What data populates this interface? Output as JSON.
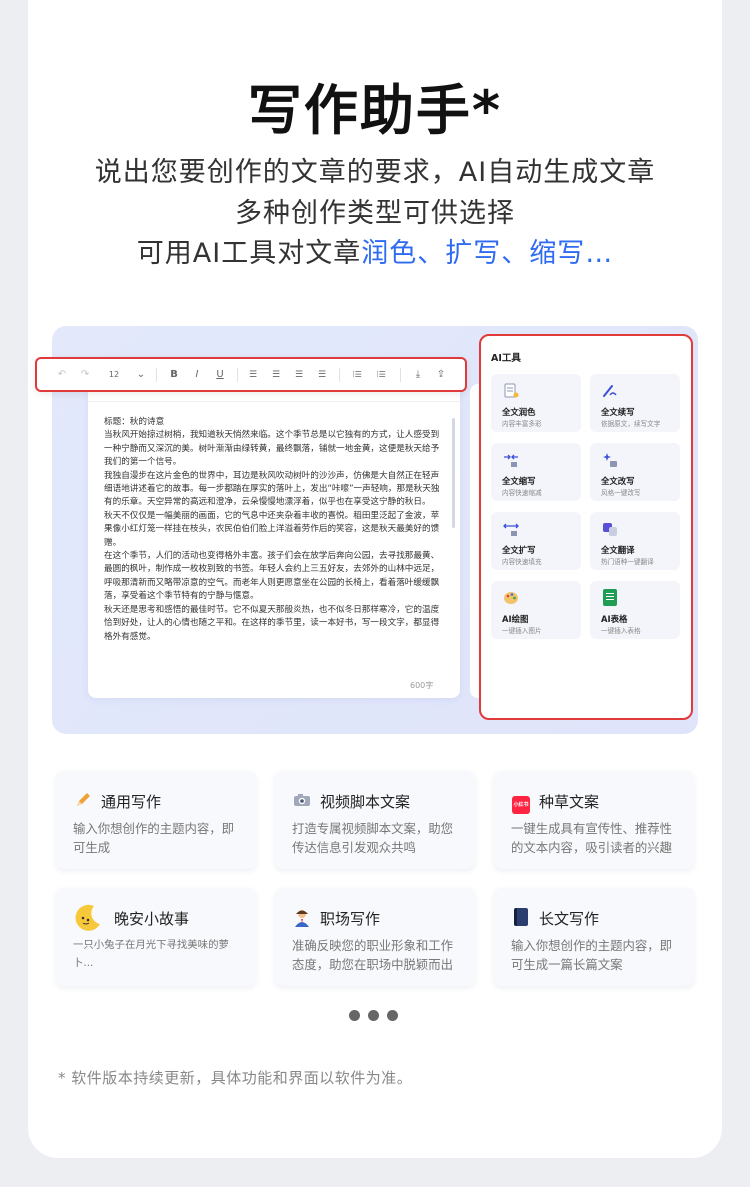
{
  "header": {
    "title": "写作助手*",
    "line1": "说出您要创作的文章的要求，AI自动生成文章",
    "line2": "多种创作类型可供选择",
    "line3_prefix": "可用AI工具对文章",
    "line3_highlight": "润色、扩写、缩写…"
  },
  "toolbar": {
    "undo_icon": "↶",
    "redo_icon": "↷",
    "font_size": "12",
    "dropdown_icon": "⌄",
    "bold": "B",
    "italic": "I",
    "underline": "U",
    "align_left_icon": "☰",
    "align_center_icon": "☰",
    "align_justify_icon": "☰",
    "align_right_icon": "☰",
    "ordered_list_icon": "⁝☰",
    "bullet_list_icon": "⁝☰",
    "download_icon": "⤓",
    "share_icon": "⇪"
  },
  "editor": {
    "text": "标题：秋的诗意\n当秋风开始掠过树梢，我知道秋天悄然来临。这个季节总是以它独有的方式，让人感受到一种宁静而又深沉的美。树叶渐渐由绿转黄，最终飘落，铺就一地金黄，这便是秋天给予我们的第一个信号。\n我独自漫步在这片金色的世界中，耳边是秋风吹动树叶的沙沙声，仿佛是大自然正在轻声细语地讲述着它的故事。每一步都踏在厚实的落叶上，发出“咔嚓”一声轻响，那是秋天独有的乐章。天空异常的高远和澄净，云朵慢慢地漂浮着，似乎也在享受这宁静的秋日。\n秋天不仅仅是一幅美丽的画面，它的气息中还夹杂着丰收的喜悦。稻田里泛起了金波，苹果像小红灯笼一样挂在枝头，农民伯伯们脸上洋溢着劳作后的笑容，这是秋天最美好的馈赠。\n在这个季节，人们的活动也变得格外丰富。孩子们会在放学后奔向公园，去寻找那最黄、最圆的枫叶，制作成一枚枚别致的书签。年轻人会约上三五好友，去郊外的山林中远足，呼吸那清新而又略带凉意的空气。而老年人则更愿意坐在公园的长椅上，看着落叶缓缓飘落，享受着这个季节特有的宁静与惬意。\n秋天还是思考和感悟的最佳时节。它不似夏天那般炎热，也不似冬日那样寒冷，它的温度恰到好处，让人的心情也随之平和。在这样的季节里，读一本好书，写一段文字，都显得格外有感觉。",
    "word_count": "600字"
  },
  "ai_tools": {
    "title": "AI工具",
    "items": [
      {
        "name": "全文润色",
        "desc": "内容丰富多彩",
        "icon": "document-sparkle-icon"
      },
      {
        "name": "全文续写",
        "desc": "依据原文，续写文字",
        "icon": "pen-loop-icon"
      },
      {
        "name": "全文缩写",
        "desc": "内容快速缩减",
        "icon": "shrink-arrows-icon"
      },
      {
        "name": "全文改写",
        "desc": "风格一键改写",
        "icon": "rewrite-sparkle-icon"
      },
      {
        "name": "全文扩写",
        "desc": "内容快速填充",
        "icon": "expand-arrows-icon"
      },
      {
        "name": "全文翻译",
        "desc": "热门语种一键翻译",
        "icon": "translate-icon"
      },
      {
        "name": "AI绘图",
        "desc": "一键插入图片",
        "icon": "palette-icon"
      },
      {
        "name": "AI表格",
        "desc": "一键插入表格",
        "icon": "spreadsheet-icon"
      }
    ]
  },
  "categories": [
    {
      "title": "通用写作",
      "desc": "输入你想创作的主题内容，即可生成",
      "icon": "pencil-icon"
    },
    {
      "title": "视频脚本文案",
      "desc": "打造专属视频脚本文案，助您传达信息引发观众共鸣",
      "icon": "camera-icon"
    },
    {
      "title": "种草文案",
      "desc": "一键生成具有宣传性、推荐性的文本内容，吸引读者的兴趣",
      "icon": "xiaohongshu-icon",
      "badge": "小红书"
    },
    {
      "title": "晚安小故事",
      "desc": "一只小兔子在月光下寻找美味的萝卜...",
      "icon": "moon-icon"
    },
    {
      "title": "职场写作",
      "desc": "准确反映您的职业形象和工作态度，助您在职场中脱颖而出",
      "icon": "businessman-icon"
    },
    {
      "title": "长文写作",
      "desc": "输入你想创作的主题内容，即可生成一篇长篇文案",
      "icon": "book-icon"
    }
  ],
  "footnote": "* 软件版本持续更新，具体功能和界面以软件为准。",
  "colors": {
    "accent": "#2f6bf2",
    "highlight_border": "#e03a3a"
  }
}
